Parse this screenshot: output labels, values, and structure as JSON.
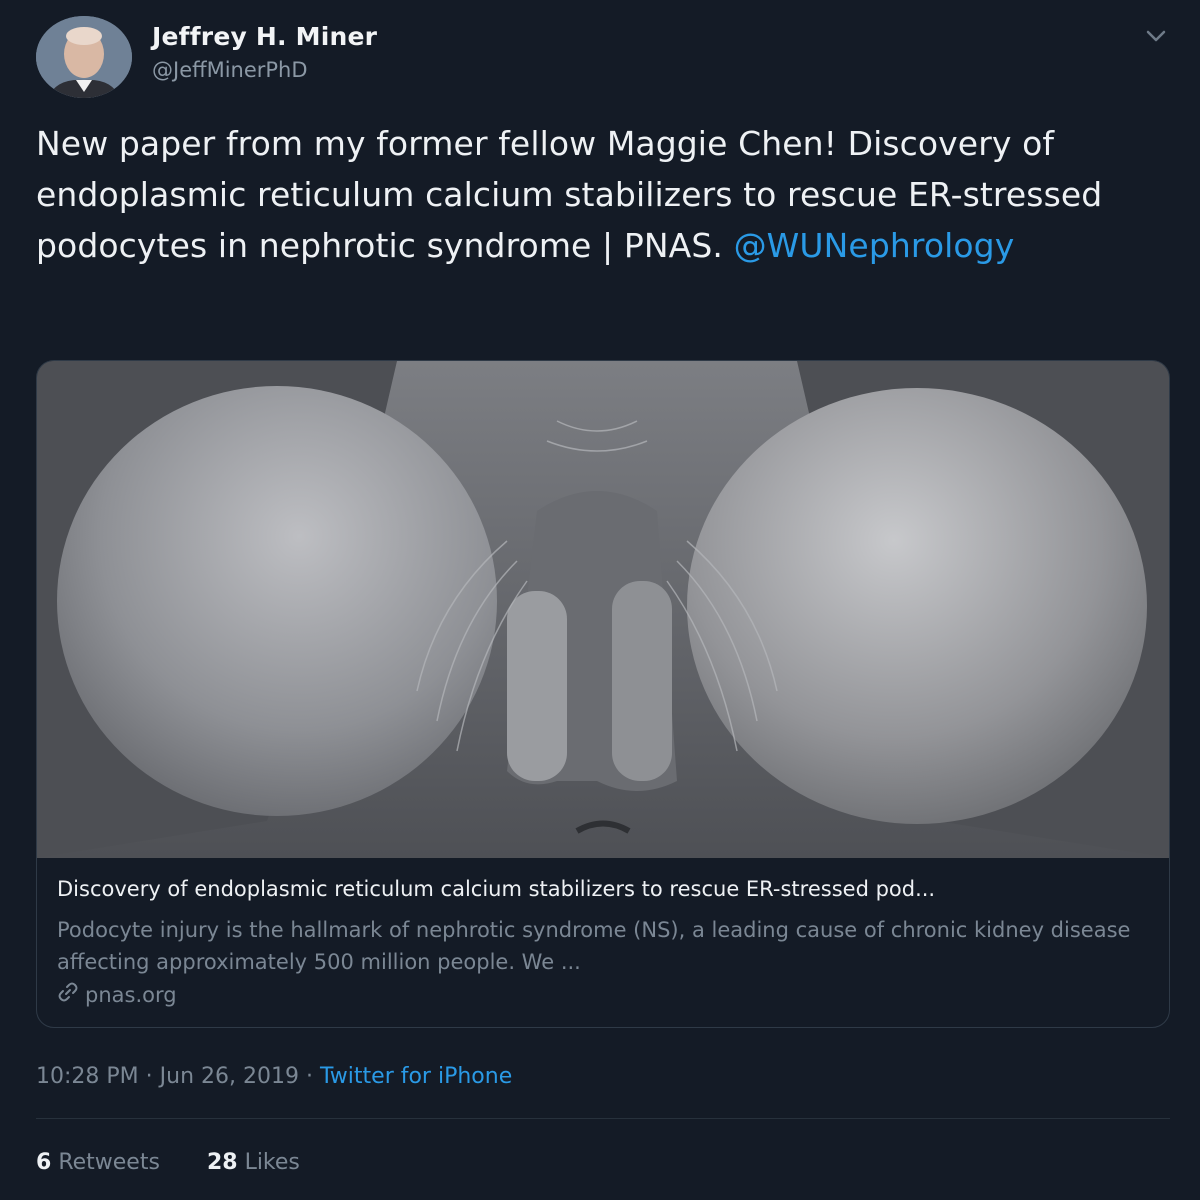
{
  "author": {
    "name": "Jeffrey H. Miner",
    "handle": "@JeffMinerPhD"
  },
  "tweet": {
    "text": "New paper from my former fellow Maggie Chen! Discovery of endoplasmic reticulum calcium stabilizers to rescue ER-stressed podocytes in nephrotic syndrome | PNAS.",
    "mention": "@WUNephrology"
  },
  "card": {
    "title": "Discovery of endoplasmic reticulum calcium stabilizers to rescue ER-stressed pod...",
    "description": "Podocyte injury is the hallmark of nephrotic syndrome (NS), a leading cause of chronic kidney disease affecting approximately 500 million people. We ...",
    "domain": "pnas.org",
    "link_icon": "link-icon"
  },
  "meta": {
    "time": "10:28 PM",
    "separator": "·",
    "date": "Jun 26, 2019",
    "source": "Twitter for iPhone"
  },
  "stats": {
    "retweets_count": "6",
    "retweets_label": "Retweets",
    "likes_count": "28",
    "likes_label": "Likes"
  },
  "colors": {
    "background": "#141b26",
    "accent": "#2a9ae6",
    "secondary_text": "#7b8794"
  }
}
